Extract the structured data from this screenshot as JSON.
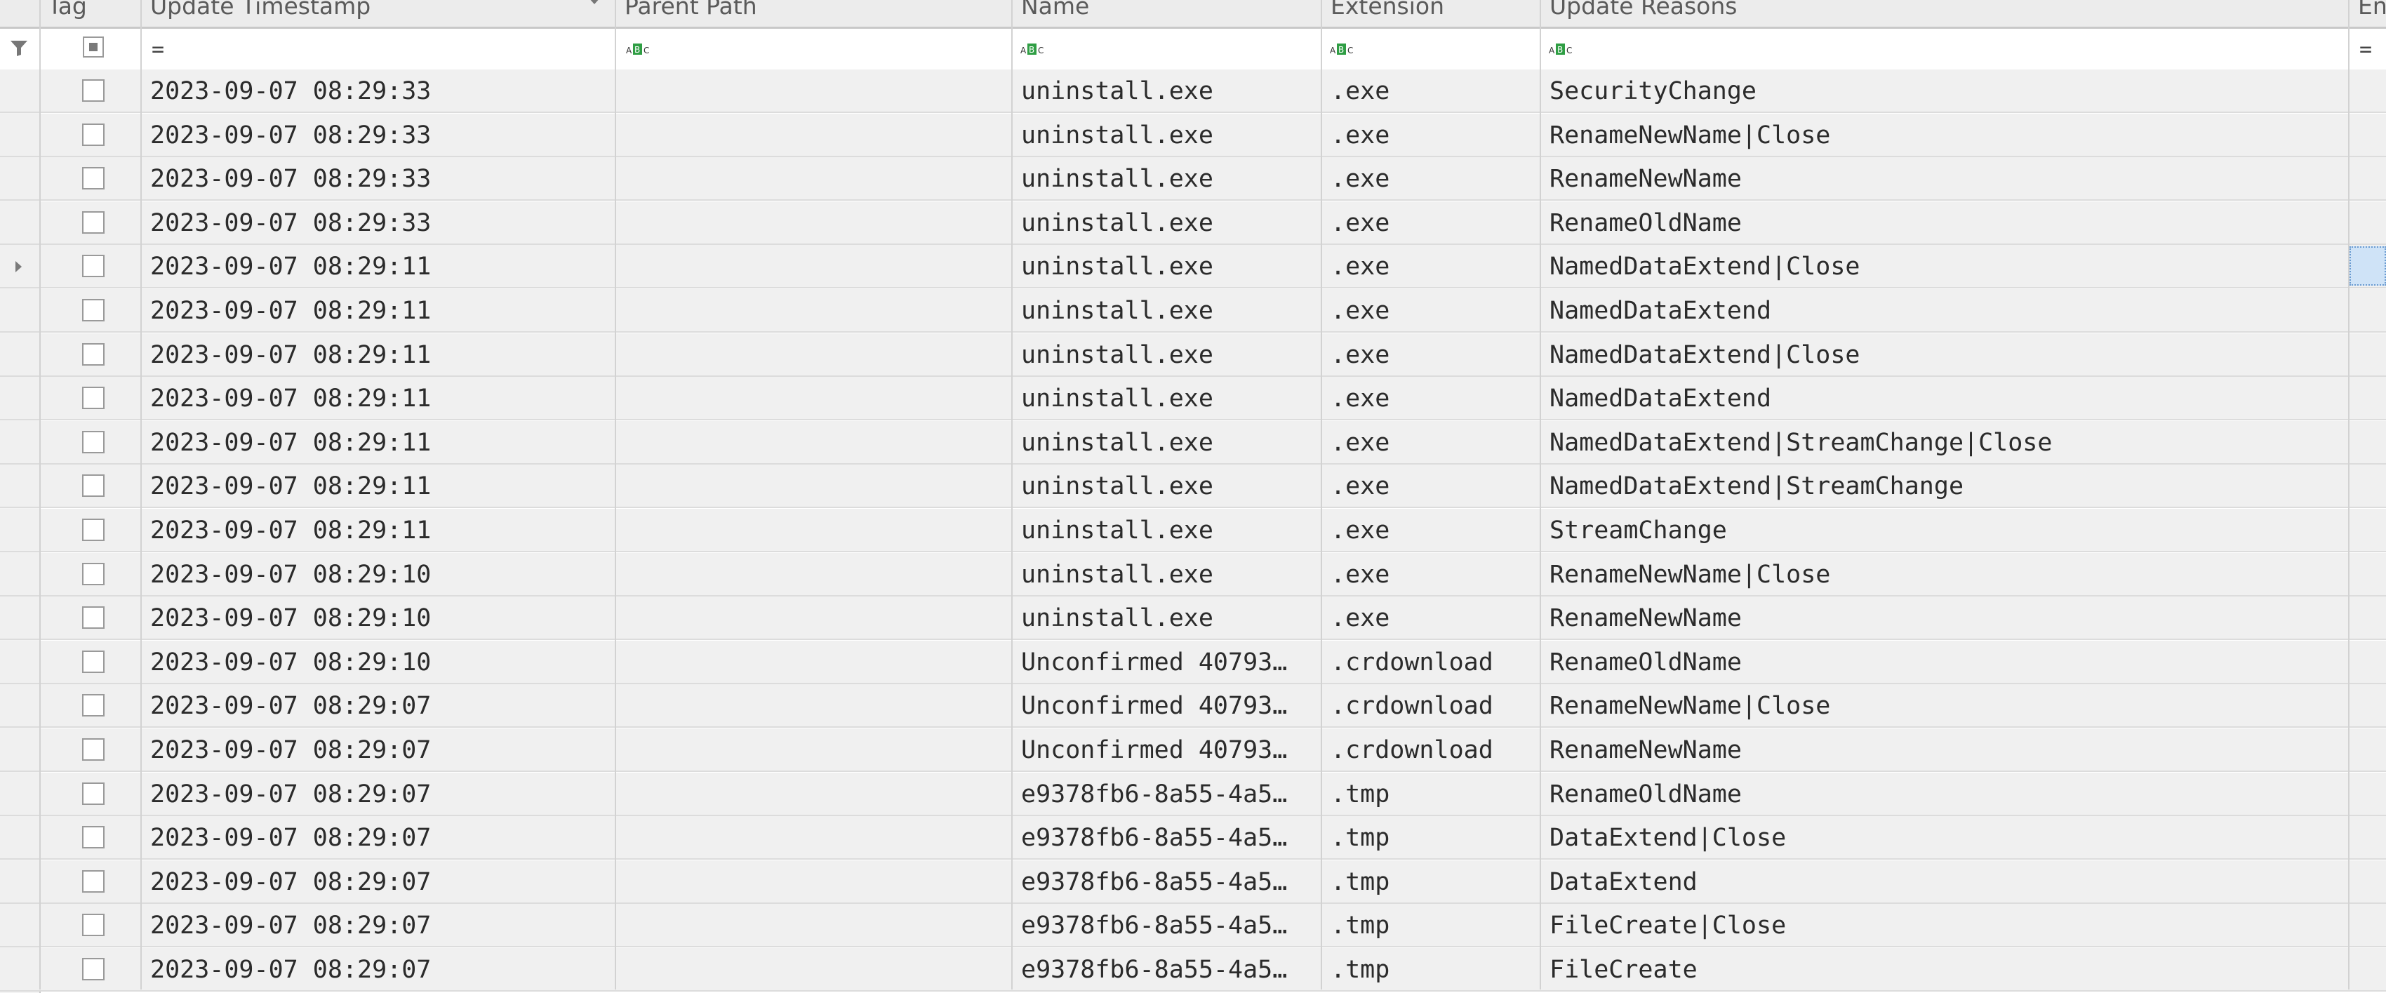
{
  "columns": {
    "tag": "Tag",
    "update_timestamp": "Update Timestamp",
    "parent_path": "Parent Path",
    "name": "Name",
    "extension": "Extension",
    "update_reasons": "Update Reasons",
    "partial_last": "En"
  },
  "filter": {
    "timestamp_op": "=",
    "last_op": "="
  },
  "selected_row_index": 4,
  "rows": [
    {
      "timestamp": "2023-09-07 08:29:33",
      "parent_path": "",
      "name": "uninstall.exe",
      "extension": ".exe",
      "reasons": "SecurityChange"
    },
    {
      "timestamp": "2023-09-07 08:29:33",
      "parent_path": "",
      "name": "uninstall.exe",
      "extension": ".exe",
      "reasons": "RenameNewName|Close"
    },
    {
      "timestamp": "2023-09-07 08:29:33",
      "parent_path": "",
      "name": "uninstall.exe",
      "extension": ".exe",
      "reasons": "RenameNewName"
    },
    {
      "timestamp": "2023-09-07 08:29:33",
      "parent_path": "",
      "name": "uninstall.exe",
      "extension": ".exe",
      "reasons": "RenameOldName"
    },
    {
      "timestamp": "2023-09-07 08:29:11",
      "parent_path": "",
      "name": "uninstall.exe",
      "extension": ".exe",
      "reasons": "NamedDataExtend|Close"
    },
    {
      "timestamp": "2023-09-07 08:29:11",
      "parent_path": "",
      "name": "uninstall.exe",
      "extension": ".exe",
      "reasons": "NamedDataExtend"
    },
    {
      "timestamp": "2023-09-07 08:29:11",
      "parent_path": "",
      "name": "uninstall.exe",
      "extension": ".exe",
      "reasons": "NamedDataExtend|Close"
    },
    {
      "timestamp": "2023-09-07 08:29:11",
      "parent_path": "",
      "name": "uninstall.exe",
      "extension": ".exe",
      "reasons": "NamedDataExtend"
    },
    {
      "timestamp": "2023-09-07 08:29:11",
      "parent_path": "",
      "name": "uninstall.exe",
      "extension": ".exe",
      "reasons": "NamedDataExtend|StreamChange|Close"
    },
    {
      "timestamp": "2023-09-07 08:29:11",
      "parent_path": "",
      "name": "uninstall.exe",
      "extension": ".exe",
      "reasons": "NamedDataExtend|StreamChange"
    },
    {
      "timestamp": "2023-09-07 08:29:11",
      "parent_path": "",
      "name": "uninstall.exe",
      "extension": ".exe",
      "reasons": "StreamChange"
    },
    {
      "timestamp": "2023-09-07 08:29:10",
      "parent_path": "",
      "name": "uninstall.exe",
      "extension": ".exe",
      "reasons": "RenameNewName|Close"
    },
    {
      "timestamp": "2023-09-07 08:29:10",
      "parent_path": "",
      "name": "uninstall.exe",
      "extension": ".exe",
      "reasons": "RenameNewName"
    },
    {
      "timestamp": "2023-09-07 08:29:10",
      "parent_path": "",
      "name": "Unconfirmed 40793…",
      "extension": ".crdownload",
      "reasons": "RenameOldName"
    },
    {
      "timestamp": "2023-09-07 08:29:07",
      "parent_path": "",
      "name": "Unconfirmed 40793…",
      "extension": ".crdownload",
      "reasons": "RenameNewName|Close"
    },
    {
      "timestamp": "2023-09-07 08:29:07",
      "parent_path": "",
      "name": "Unconfirmed 40793…",
      "extension": ".crdownload",
      "reasons": "RenameNewName"
    },
    {
      "timestamp": "2023-09-07 08:29:07",
      "parent_path": "",
      "name": "e9378fb6-8a55-4a5…",
      "extension": ".tmp",
      "reasons": "RenameOldName"
    },
    {
      "timestamp": "2023-09-07 08:29:07",
      "parent_path": "",
      "name": "e9378fb6-8a55-4a5…",
      "extension": ".tmp",
      "reasons": "DataExtend|Close"
    },
    {
      "timestamp": "2023-09-07 08:29:07",
      "parent_path": "",
      "name": "e9378fb6-8a55-4a5…",
      "extension": ".tmp",
      "reasons": "DataExtend"
    },
    {
      "timestamp": "2023-09-07 08:29:07",
      "parent_path": "",
      "name": "e9378fb6-8a55-4a5…",
      "extension": ".tmp",
      "reasons": "FileCreate|Close"
    },
    {
      "timestamp": "2023-09-07 08:29:07",
      "parent_path": "",
      "name": "e9378fb6-8a55-4a5…",
      "extension": ".tmp",
      "reasons": "FileCreate"
    }
  ]
}
